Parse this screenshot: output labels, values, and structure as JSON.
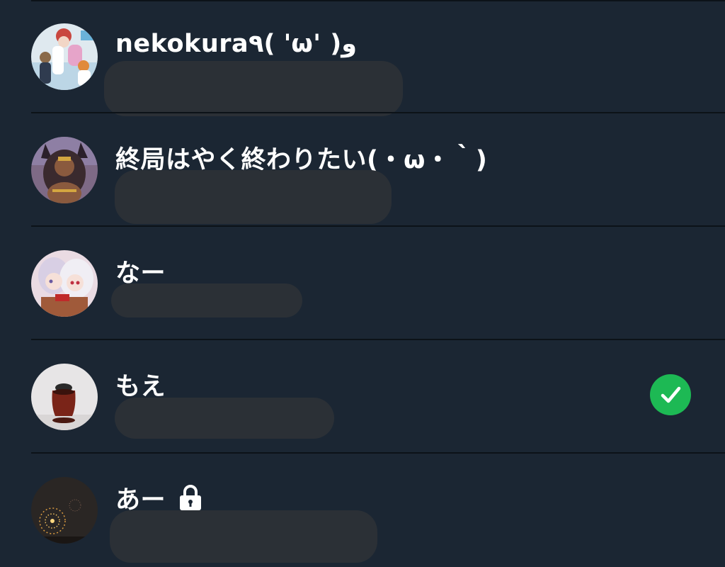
{
  "colors": {
    "background": "#1b2633",
    "divider": "#0c1218",
    "redacted_bar": "#2b3036",
    "name_text": "#ffffff",
    "selected_check": "#1db954"
  },
  "contacts": [
    {
      "name": "nekokura٩( 'ω' )و",
      "avatar_icon": "user-avatar-icon"
    },
    {
      "name": "終局はやく終わりたい(・ω・｀)",
      "avatar_icon": "user-avatar-icon"
    },
    {
      "name": "なー",
      "avatar_icon": "user-avatar-icon"
    },
    {
      "name": "もえ",
      "avatar_icon": "user-avatar-icon",
      "selected": true,
      "selected_icon": "check-circle-icon"
    },
    {
      "name": "あー",
      "avatar_icon": "user-avatar-icon",
      "locked": true,
      "locked_icon": "lock-icon"
    }
  ]
}
